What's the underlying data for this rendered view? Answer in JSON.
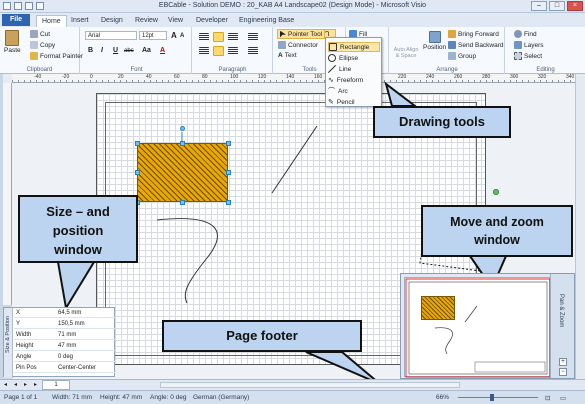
{
  "window": {
    "title": "EBCable - Solution DEMO : 20_KAB A4 Landscape02 (Design Mode) - Microsoft Visio",
    "buttons": {
      "minimize": "–",
      "maximize": "□",
      "close": "×"
    }
  },
  "tabs": [
    "File",
    "Home",
    "Insert",
    "Design",
    "Review",
    "View",
    "Developer",
    "Engineering Base"
  ],
  "ribbon": {
    "clipboard": {
      "paste": "Paste",
      "cut": "Cut",
      "copy": "Copy",
      "format_painter": "Format Painter",
      "label": "Clipboard"
    },
    "font": {
      "family": "Arial",
      "size": "12pt",
      "grow": "A",
      "shrink": "A",
      "bold": "B",
      "italic": "I",
      "underline": "U",
      "strike": "abc",
      "case": "Aa",
      "color": "A",
      "label": "Font"
    },
    "paragraph": {
      "label": "Paragraph"
    },
    "tools": {
      "pointer": "Pointer Tool",
      "connector": "Connector",
      "text": "Text",
      "label": "Tools"
    },
    "shape": {
      "fill": "Fill",
      "line": "Line",
      "shadow": "Shadow"
    },
    "arrange": {
      "auto_align": "Auto Align & Space",
      "position": "Position",
      "bring_forward": "Bring Forward",
      "send_backward": "Send Backward",
      "group": "Group",
      "label": "Arrange"
    },
    "editing": {
      "find": "Find",
      "layers": "Layers",
      "select": "Select",
      "label": "Editing"
    }
  },
  "drawing_menu": [
    {
      "label": "Rectangle",
      "icon": "rectangle-icon",
      "selected": true
    },
    {
      "label": "Ellipse",
      "icon": "ellipse-icon",
      "selected": false
    },
    {
      "label": "Line",
      "icon": "line-icon",
      "selected": false
    },
    {
      "label": "Freeform",
      "icon": "freeform-icon",
      "selected": false
    },
    {
      "label": "Arc",
      "icon": "arc-icon",
      "selected": false
    },
    {
      "label": "Pencil",
      "icon": "pencil-icon",
      "selected": false
    }
  ],
  "ruler_labels": [
    "-40",
    "-20",
    "0",
    "20",
    "40",
    "60",
    "80",
    "100",
    "120",
    "140",
    "160",
    "180",
    "200",
    "220",
    "240",
    "260",
    "280",
    "300",
    "320",
    "340"
  ],
  "callouts": {
    "drawing_tools": "Drawing tools",
    "size_position": "Size – and position window",
    "move_zoom": "Move and zoom window",
    "page_footer": "Page footer"
  },
  "size_position": {
    "title": "Size & Position",
    "rows": [
      {
        "key": "X",
        "value": "64,5 mm"
      },
      {
        "key": "Y",
        "value": "150,5 mm"
      },
      {
        "key": "Width",
        "value": "71 mm"
      },
      {
        "key": "Height",
        "value": "47 mm"
      },
      {
        "key": "Angle",
        "value": "0 deg"
      },
      {
        "key": "Pin Pos",
        "value": "Center-Center"
      }
    ]
  },
  "pan_zoom": {
    "title": "Pan & Zoom"
  },
  "sheet": {
    "page_number": "1"
  },
  "status": {
    "page": "Page 1 of 1",
    "width": "Width: 71 mm",
    "height": "Height: 47 mm",
    "angle": "Angle: 0 deg",
    "language": "German (Germany)",
    "zoom": "66%"
  },
  "colors": {
    "accent": "#2f64b0",
    "hatch": "#e8a800",
    "callout": "#bcd4ef"
  }
}
